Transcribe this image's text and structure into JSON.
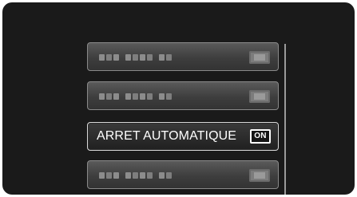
{
  "menu": {
    "items": [
      {
        "label": "",
        "placeholder": true
      },
      {
        "label": "",
        "placeholder": true
      },
      {
        "label": "ARRET AUTOMATIQUE",
        "value": "ON",
        "selected": true
      },
      {
        "label": "",
        "placeholder": true
      }
    ]
  },
  "icons": {
    "value_badge": "on-badge-icon"
  },
  "colors": {
    "screen_bg": "#1a1a1a",
    "item_bg": "#3e3e3e",
    "selected_border": "#d8d8d8",
    "text": "#ffffff"
  }
}
